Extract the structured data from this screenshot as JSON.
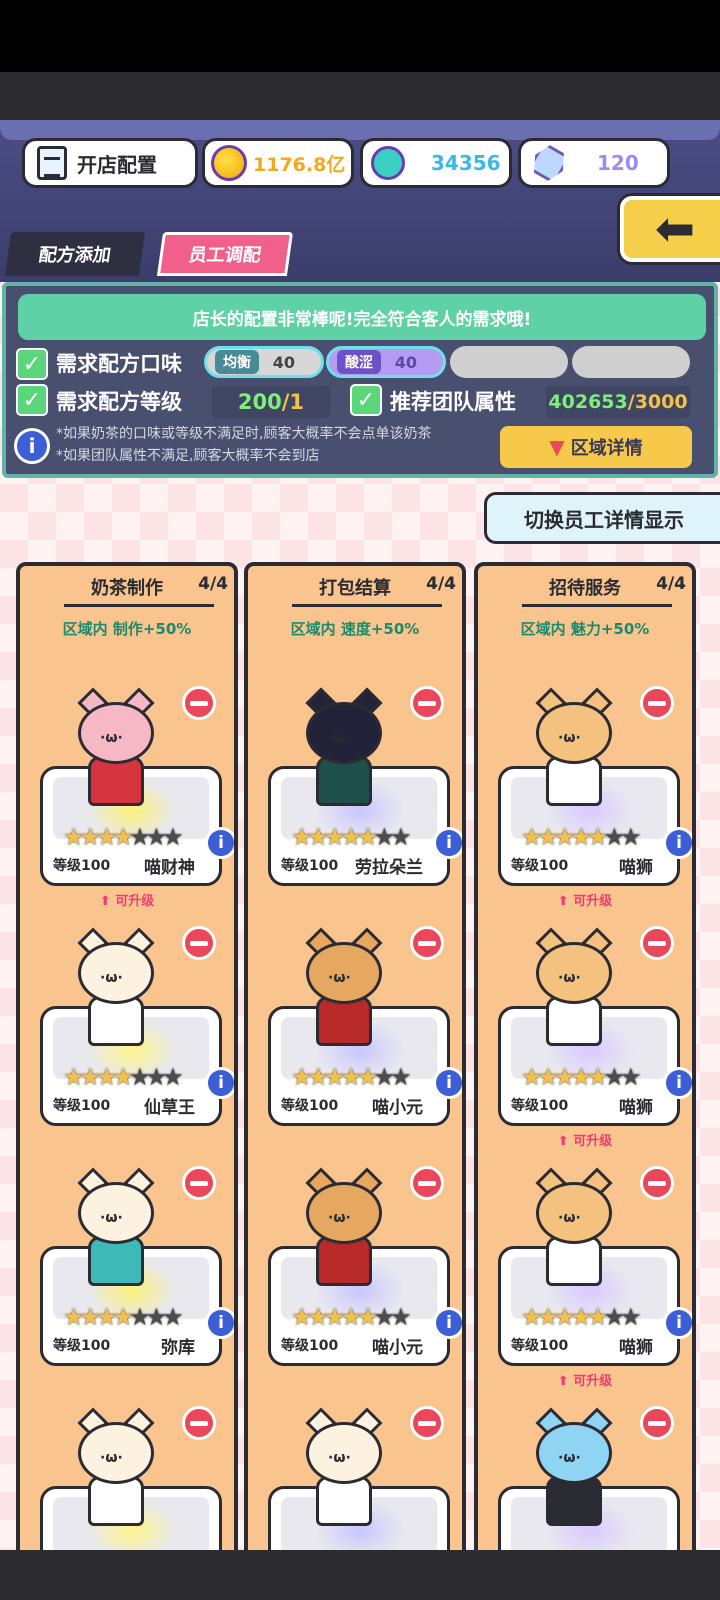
{
  "top": {
    "config_label": "开店配置",
    "coins": "1176.8亿",
    "notes": "34356",
    "gems": "120"
  },
  "tabs": {
    "recipe": "配方添加",
    "staff": "员工调配"
  },
  "panel": {
    "banner": "店长的配置非常棒呢!完全符合客人的需求哦!",
    "row1_label": "需求配方口味",
    "flavor1_tag": "均衡",
    "flavor1_value": "40",
    "flavor2_tag": "酸涩",
    "flavor2_value": "40",
    "row2_label": "需求配方等级",
    "level_current": "200",
    "level_sep": "/1",
    "team_label": "推荐团队属性",
    "team_current": "402653",
    "team_sep": "/3000",
    "hint1": "*如果奶茶的口味或等级不满足时,顾客大概率不会点单该奶茶",
    "hint2": "*如果团队属性不满足,顾客大概率不会到店",
    "area_button": "区域详情",
    "check_mark": "✓"
  },
  "switch_button": "切换员工详情显示",
  "columns": [
    {
      "title": "奶茶制作",
      "count": "4/4",
      "bonus": "区域内 制作+50%",
      "staff": [
        {
          "level": "等级100",
          "name": "喵财神",
          "upgrade": "可升级",
          "stars": 4
        },
        {
          "level": "等级100",
          "name": "仙草王",
          "upgrade": "",
          "stars": 4
        },
        {
          "level": "等级100",
          "name": "弥库",
          "upgrade": "",
          "stars": 4
        }
      ]
    },
    {
      "title": "打包结算",
      "count": "4/4",
      "bonus": "区域内 速度+50%",
      "staff": [
        {
          "level": "等级100",
          "name": "劳拉朵兰",
          "upgrade": "",
          "stars": 5
        },
        {
          "level": "等级100",
          "name": "喵小元",
          "upgrade": "",
          "stars": 5
        },
        {
          "level": "等级100",
          "name": "喵小元",
          "upgrade": "",
          "stars": 5
        }
      ]
    },
    {
      "title": "招待服务",
      "count": "4/4",
      "bonus": "区域内 魅力+50%",
      "staff": [
        {
          "level": "等级100",
          "name": "喵狮",
          "upgrade": "可升级",
          "stars": 5
        },
        {
          "level": "等级100",
          "name": "喵狮",
          "upgrade": "可升级",
          "stars": 5
        },
        {
          "level": "等级100",
          "name": "喵狮",
          "upgrade": "可升级",
          "stars": 5
        }
      ]
    }
  ],
  "colors": {
    "accent_pink": "#f0608a",
    "accent_green": "#5fd1a7",
    "gold": "#f6c94b"
  }
}
